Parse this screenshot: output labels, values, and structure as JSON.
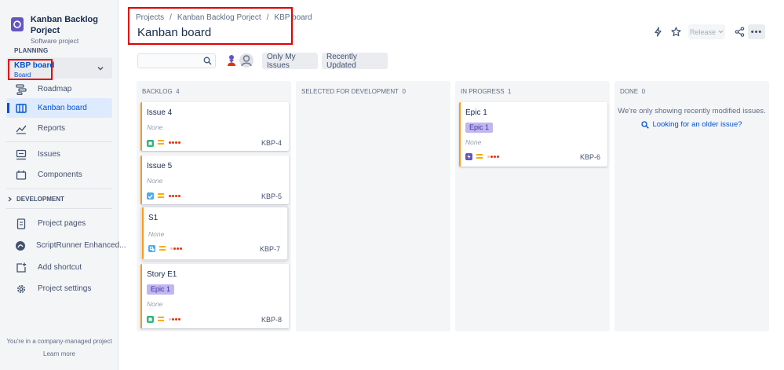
{
  "sidebar": {
    "project_name": "Kanban Backlog Porject",
    "project_type": "Software project",
    "planning_label": "PLANNING",
    "board_selector": {
      "label": "KBP board",
      "sub": "Board"
    },
    "planning_items": [
      {
        "label": "Roadmap",
        "icon": "roadmap-icon"
      },
      {
        "label": "Kanban board",
        "icon": "board-icon"
      },
      {
        "label": "Reports",
        "icon": "chart-icon"
      }
    ],
    "project_items": [
      {
        "label": "Issues",
        "icon": "inbox-icon"
      },
      {
        "label": "Components",
        "icon": "component-icon"
      }
    ],
    "development_label": "DEVELOPMENT",
    "bottom_items": [
      {
        "label": "Project pages",
        "icon": "page-icon"
      },
      {
        "label": "ScriptRunner Enhanced...",
        "icon": "scriptrunner-icon"
      },
      {
        "label": "Add shortcut",
        "icon": "add-shortcut-icon"
      },
      {
        "label": "Project settings",
        "icon": "gear-icon"
      }
    ],
    "footer_text": "You're in a company-managed project",
    "learn_more": "Learn more"
  },
  "header": {
    "breadcrumb": [
      "Projects",
      "Kanban Backlog Porject",
      "KBP board"
    ],
    "title": "Kanban board",
    "release_label": "Release",
    "more_label": "•••"
  },
  "filters": {
    "search_placeholder": "",
    "only_my_issues": "Only My Issues",
    "recently_updated": "Recently Updated"
  },
  "board": {
    "columns": [
      {
        "title": "BACKLOG",
        "count": "4"
      },
      {
        "title": "SELECTED FOR DEVELOPMENT",
        "count": "0"
      },
      {
        "title": "IN PROGRESS",
        "count": "1"
      },
      {
        "title": "DONE",
        "count": "0"
      }
    ],
    "cards": [
      {
        "title": "Issue 4",
        "none": "None",
        "key": "KBP-4",
        "type": "story"
      },
      {
        "title": "Issue 5",
        "none": "None",
        "key": "KBP-5",
        "type": "task"
      },
      {
        "title": "S1",
        "none": "None",
        "key": "KBP-7",
        "type": "subtask"
      },
      {
        "title": "Story E1",
        "epic": "Epic 1",
        "none": "None",
        "key": "KBP-8",
        "type": "story"
      },
      {
        "title": "Epic 1",
        "epic": "Epic 1",
        "none": "None",
        "key": "KBP-6",
        "type": "epic"
      }
    ],
    "done_message": "We're only showing recently modified issues.",
    "done_link": "Looking for an older issue?"
  },
  "colors": {
    "accent": "#0052cc",
    "highlight": "#e30000",
    "card_border": "#ff991f",
    "epic_bg": "#c0b6f2"
  }
}
